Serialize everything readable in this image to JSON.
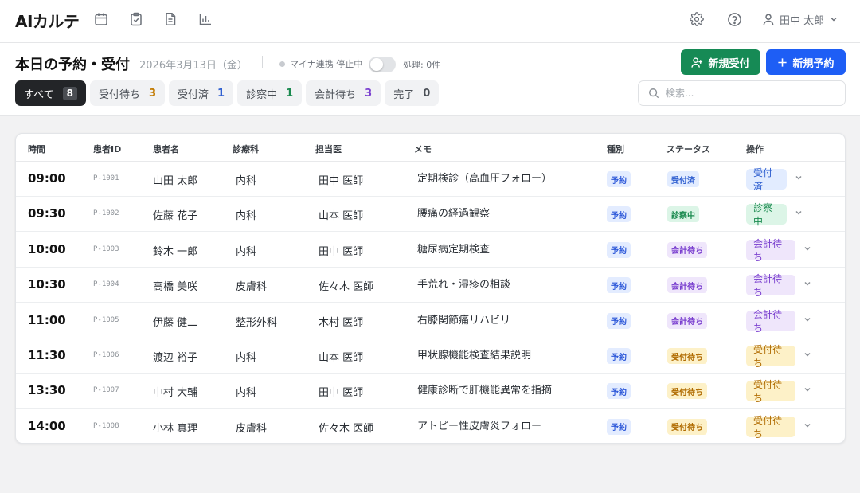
{
  "app": {
    "name": "AIカルテ"
  },
  "user": {
    "name": "田中 太郎"
  },
  "header": {
    "title": "本日の予約・受付",
    "date": "2026年3月13日（金）",
    "myna_status": "マイナ連携 停止中",
    "processing": "処理: 0件",
    "new_reception_label": "新規受付",
    "new_appointment_label": "新規予約"
  },
  "filters": [
    {
      "label": "すべて",
      "count": "8",
      "color": "#ffffff"
    },
    {
      "label": "受付待ち",
      "count": "3",
      "color": "#c27a00"
    },
    {
      "label": "受付済",
      "count": "1",
      "color": "#2f5fd0"
    },
    {
      "label": "診察中",
      "count": "1",
      "color": "#1a8a4f"
    },
    {
      "label": "会計待ち",
      "count": "3",
      "color": "#7a3fcf"
    },
    {
      "label": "完了",
      "count": "0",
      "color": "#4b5057"
    }
  ],
  "search": {
    "placeholder": "検索..."
  },
  "table": {
    "columns": [
      "時間",
      "患者ID",
      "患者名",
      "診療科",
      "担当医",
      "メモ",
      "種別",
      "ステータス",
      "操作"
    ],
    "rows": [
      {
        "time": "09:00",
        "id": "P-1001",
        "name": "山田 太郎",
        "dept": "内科",
        "doctor": "田中 医師",
        "memo": "定期検診（高血圧フォロー）",
        "type": "予約",
        "status": "受付済",
        "status_class": "st-done",
        "action": "受付済"
      },
      {
        "time": "09:30",
        "id": "P-1002",
        "name": "佐藤 花子",
        "dept": "内科",
        "doctor": "山本 医師",
        "memo": "腰痛の経過観察",
        "type": "予約",
        "status": "診察中",
        "status_class": "st-exam",
        "action": "診察中"
      },
      {
        "time": "10:00",
        "id": "P-1003",
        "name": "鈴木 一郎",
        "dept": "内科",
        "doctor": "田中 医師",
        "memo": "糖尿病定期検査",
        "type": "予約",
        "status": "会計待ち",
        "status_class": "st-bill",
        "action": "会計待ち"
      },
      {
        "time": "10:30",
        "id": "P-1004",
        "name": "高橋 美咲",
        "dept": "皮膚科",
        "doctor": "佐々木 医師",
        "memo": "手荒れ・湿疹の相談",
        "type": "予約",
        "status": "会計待ち",
        "status_class": "st-bill",
        "action": "会計待ち"
      },
      {
        "time": "11:00",
        "id": "P-1005",
        "name": "伊藤 健二",
        "dept": "整形外科",
        "doctor": "木村 医師",
        "memo": "右膝関節痛リハビリ",
        "type": "予約",
        "status": "会計待ち",
        "status_class": "st-bill",
        "action": "会計待ち"
      },
      {
        "time": "11:30",
        "id": "P-1006",
        "name": "渡辺 裕子",
        "dept": "内科",
        "doctor": "山本 医師",
        "memo": "甲状腺機能検査結果説明",
        "type": "予約",
        "status": "受付待ち",
        "status_class": "st-wait",
        "action": "受付待ち"
      },
      {
        "time": "13:30",
        "id": "P-1007",
        "name": "中村 大輔",
        "dept": "内科",
        "doctor": "田中 医師",
        "memo": "健康診断で肝機能異常を指摘",
        "type": "予約",
        "status": "受付待ち",
        "status_class": "st-wait",
        "action": "受付待ち"
      },
      {
        "time": "14:00",
        "id": "P-1008",
        "name": "小林 真理",
        "dept": "皮膚科",
        "doctor": "佐々木 医師",
        "memo": "アトピー性皮膚炎フォロー",
        "type": "予約",
        "status": "受付待ち",
        "status_class": "st-wait",
        "action": "受付待ち"
      }
    ]
  },
  "icons": {
    "nav": [
      "calendar-icon",
      "clipboard-icon",
      "document-icon",
      "chart-icon"
    ],
    "top_right": [
      "gear-icon",
      "help-icon",
      "user-icon"
    ]
  },
  "colors": {
    "primary_blue": "#1e5ef5",
    "primary_green": "#168a55",
    "dark_chip": "#232528"
  }
}
